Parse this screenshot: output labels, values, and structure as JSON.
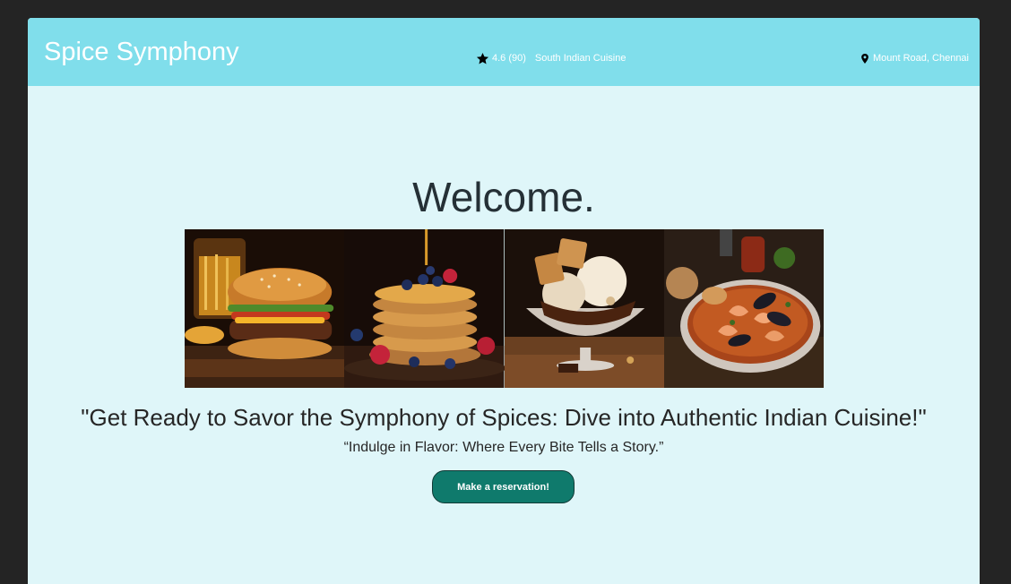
{
  "header": {
    "brand": "Spice Symphony",
    "rating": "4.6 (90)",
    "cuisine": "South Indian Cuisine",
    "location": "Mount Road, Chennai"
  },
  "hero": {
    "welcome": "Welcome.",
    "headline": "\"Get Ready to Savor the Symphony of Spices: Dive into Authentic Indian Cuisine!\"",
    "tagline": "“Indulge in Flavor: Where Every Bite Tells a Story.”",
    "cta_label": "Make a reservation!"
  },
  "gallery": {
    "images": [
      "burger-image",
      "pancakes-image",
      "ice-cream-sundae-image",
      "seafood-stew-image"
    ]
  },
  "colors": {
    "header_bg": "#80deeb",
    "page_bg": "#dff6f9",
    "button_bg": "#0f7a6c",
    "outer_bg": "#242424"
  },
  "icons": {
    "rating": "star-icon",
    "location": "location-pin-icon"
  }
}
